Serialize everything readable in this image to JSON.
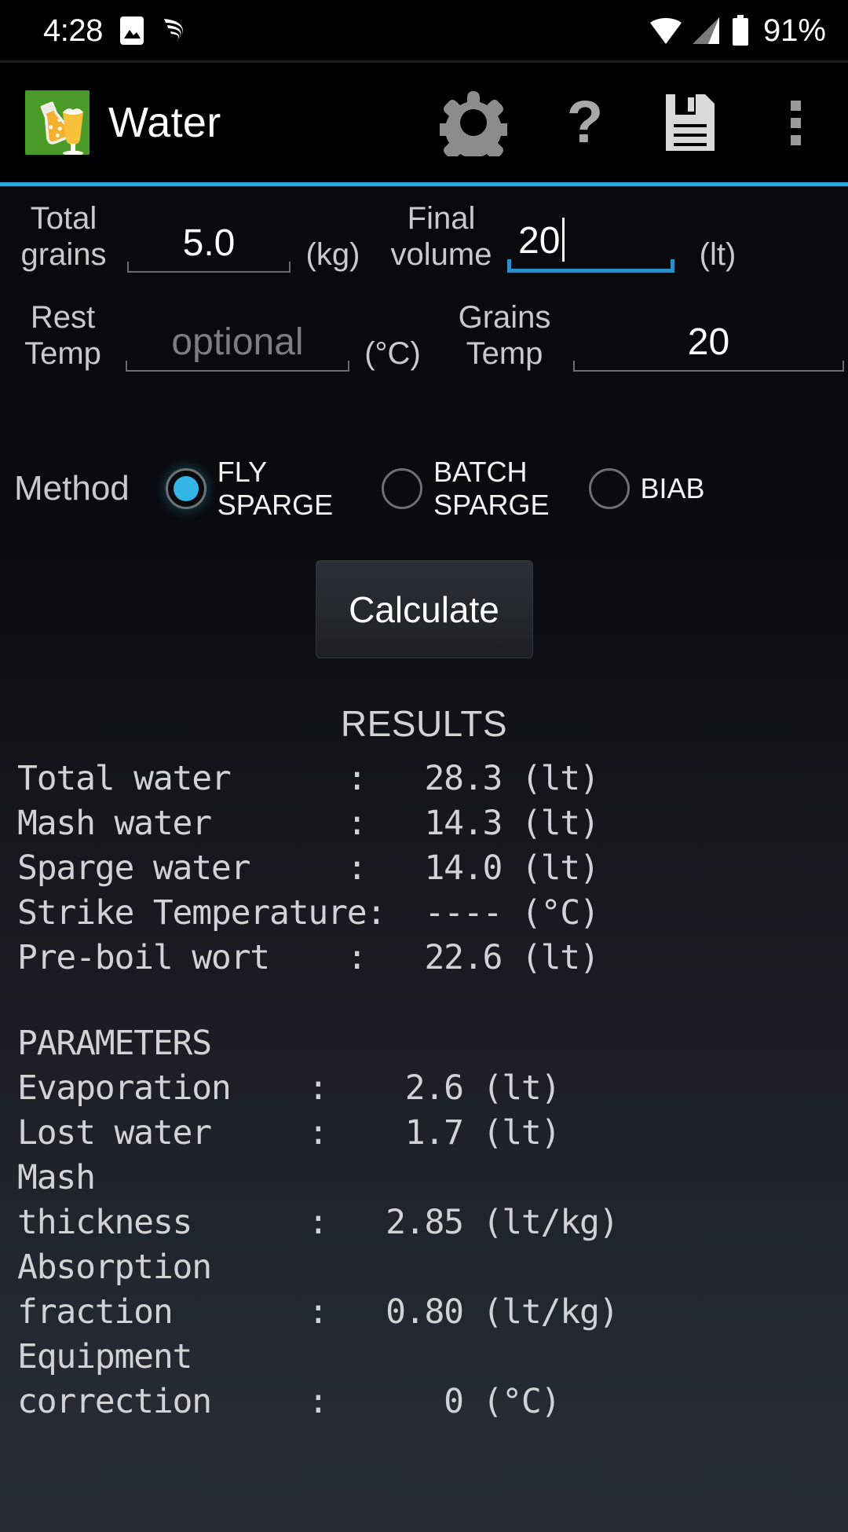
{
  "status_bar": {
    "time": "4:28",
    "battery_percent": "91%",
    "icons": [
      "image-icon",
      "swirl-icon",
      "wifi-icon",
      "cellular-signal-icon",
      "battery-icon"
    ]
  },
  "app_bar": {
    "title": "Water",
    "app_icon_name": "beer-brewing-app-icon",
    "actions": [
      {
        "name": "settings-gear-icon",
        "label": "Settings"
      },
      {
        "name": "help-question-icon",
        "label": "?"
      },
      {
        "name": "save-floppy-icon",
        "label": "Save"
      },
      {
        "name": "overflow-menu-icon",
        "label": "More options"
      }
    ],
    "accent_color": "#2da5dd"
  },
  "form": {
    "total_grains": {
      "label": "Total\ngrains",
      "value": "5.0",
      "unit": "(kg)",
      "focused": false
    },
    "final_volume": {
      "label": "Final\nvolume",
      "value": "20",
      "unit": "(lt)",
      "focused": true
    },
    "rest_temp": {
      "label": "Rest\nTemp",
      "value": "",
      "placeholder": "optional",
      "unit": "(°C)",
      "focused": false
    },
    "grains_temp": {
      "label": "Grains\nTemp",
      "value": "20",
      "unit": "",
      "focused": false
    }
  },
  "method": {
    "label": "Method",
    "selected": "FLY SPARGE",
    "options": [
      {
        "id": "fly-sparge",
        "label": "FLY\nSPARGE",
        "selected": true
      },
      {
        "id": "batch-sparge",
        "label": "BATCH\nSPARGE",
        "selected": false
      },
      {
        "id": "biab",
        "label": "BIAB",
        "selected": false
      }
    ],
    "selected_color": "#33b5e5"
  },
  "calculate_button": {
    "label": "Calculate"
  },
  "results": {
    "heading": "RESULTS",
    "lines": [
      {
        "label": "Total water",
        "sep": ":",
        "value": "28.3",
        "unit": "(lt)"
      },
      {
        "label": "Mash water",
        "sep": ":",
        "value": "14.3",
        "unit": "(lt)"
      },
      {
        "label": "Sparge water",
        "sep": ":",
        "value": "14.0",
        "unit": "(lt)"
      },
      {
        "label": "Strike Temperature",
        "sep": ":",
        "value": "----",
        "unit": "(°C)"
      },
      {
        "label": "Pre-boil wort",
        "sep": ":",
        "value": "22.6",
        "unit": "(lt)"
      }
    ],
    "text": "Total water      :   28.3 (lt)\nMash water       :   14.3 (lt)\nSparge water     :   14.0 (lt)\nStrike Temperature:  ---- (°C)\nPre-boil wort    :   22.6 (lt)"
  },
  "parameters": {
    "heading": "PARAMETERS",
    "lines": [
      {
        "label": "Evaporation",
        "sep": ":",
        "value": "2.6",
        "unit": "(lt)"
      },
      {
        "label": "Lost water",
        "sep": ":",
        "value": "1.7",
        "unit": "(lt)"
      },
      {
        "label": "Mash thickness",
        "sep": ":",
        "value": "2.85",
        "unit": "(lt/kg)"
      },
      {
        "label": "Absorption fraction",
        "sep": ":",
        "value": "0.80",
        "unit": "(lt/kg)"
      },
      {
        "label": "Equipment correction",
        "sep": ":",
        "value": "0",
        "unit": "(°C)"
      }
    ],
    "text": "PARAMETERS\nEvaporation    :    2.6 (lt)\nLost water     :    1.7 (lt)\nMash\nthickness      :   2.85 (lt/kg)\nAbsorption\nfraction       :   0.80 (lt/kg)\nEquipment\ncorrection     :      0 (°C)"
  }
}
